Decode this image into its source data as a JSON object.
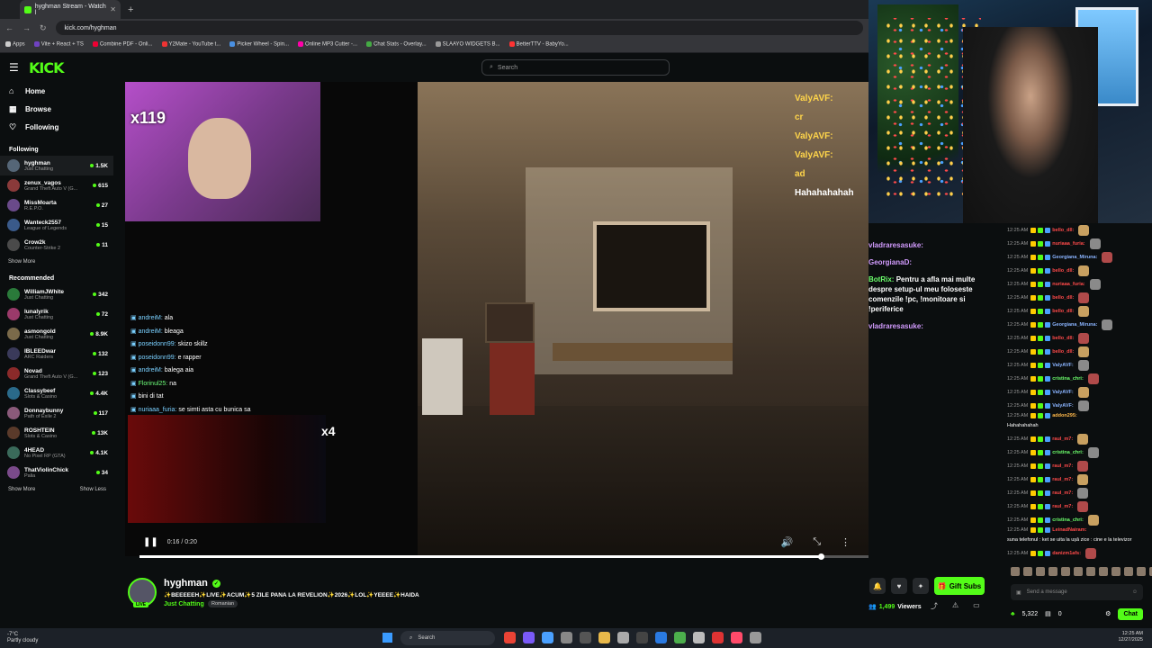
{
  "browser": {
    "tab_title": "hyghman Stream - Watch l",
    "url": "kick.com/hyghman",
    "bookmarks": [
      "Apps",
      "Vite + React + TS",
      "Combine PDF - Onli...",
      "Y2Mate - YouTube t...",
      "Picker Wheel - Spin...",
      "Online MP3 Cutter -...",
      "Chat Stats - Overlay...",
      "SLAAYO WIDGETS B...",
      "BetterTTV - BabyYo..."
    ]
  },
  "header": {
    "logo": "KICK",
    "search_placeholder": "Search"
  },
  "sidebar": {
    "nav": [
      {
        "label": "Home",
        "icon": "home-icon"
      },
      {
        "label": "Browse",
        "icon": "browse-icon"
      },
      {
        "label": "Following",
        "icon": "heart-icon"
      }
    ],
    "following_title": "Following",
    "following": [
      {
        "name": "hyghman",
        "category": "Just Chatting",
        "viewers": "1.5K",
        "color": "#556677"
      },
      {
        "name": "zenux_vagos",
        "category": "Grand Theft Auto V (G...",
        "viewers": "615",
        "color": "#8a3a3a"
      },
      {
        "name": "MissMoarta",
        "category": "R.E.P.O.",
        "viewers": "27",
        "color": "#6a4a8a"
      },
      {
        "name": "Wanteck2557",
        "category": "League of Legends",
        "viewers": "15",
        "color": "#3a5a8a"
      },
      {
        "name": "Crow2k",
        "category": "Counter-Strike 2",
        "viewers": "11",
        "color": "#4a4a4a"
      }
    ],
    "show_more": "Show More",
    "recommended_title": "Recommended",
    "recommended": [
      {
        "name": "WilliamJWhite",
        "category": "Just Chatting",
        "viewers": "342",
        "color": "#2a7a3a"
      },
      {
        "name": "lunalyrik",
        "category": "Just Chatting",
        "viewers": "72",
        "color": "#9a3a6a"
      },
      {
        "name": "asmongold",
        "category": "Just Chatting",
        "viewers": "8.9K",
        "color": "#7a6a4a"
      },
      {
        "name": "IBLEEDwar",
        "category": "ARC Raiders",
        "viewers": "132",
        "color": "#3a3a5a"
      },
      {
        "name": "Novad",
        "category": "Grand Theft Auto V (G...",
        "viewers": "123",
        "color": "#8a2a2a"
      },
      {
        "name": "Classybeef",
        "category": "Slots & Casino",
        "viewers": "4.4K",
        "color": "#2a6a8a"
      },
      {
        "name": "Donnaybunny",
        "category": "Path of Exile 2",
        "viewers": "117",
        "color": "#8a5a7a"
      },
      {
        "name": "ROSHTEIN",
        "category": "Slots & Casino",
        "viewers": "13K",
        "color": "#5a3a2a"
      },
      {
        "name": "4HEAD",
        "category": "No Pixel RP (GTA)",
        "viewers": "4.1K",
        "color": "#3a6a5a"
      },
      {
        "name": "ThatViolinChick",
        "category": "Palia",
        "viewers": "34",
        "color": "#7a4a8a"
      }
    ],
    "show_less": "Show Less"
  },
  "video": {
    "top_cam_badge": "x119",
    "bottom_cam_badge": "x4",
    "overlay_chat": [
      {
        "user": "andreiM:",
        "msg": "ala",
        "cls": "u1"
      },
      {
        "user": "andreiM:",
        "msg": "bleaga",
        "cls": "u1"
      },
      {
        "user": "poseidonn99:",
        "msg": "skizo skillz",
        "cls": "u1"
      },
      {
        "user": "poseidonn99:",
        "msg": "e rapper",
        "cls": "u1"
      },
      {
        "user": "andreiM:",
        "msg": "balega aia",
        "cls": "u1"
      },
      {
        "user": "Florinul25:",
        "msg": "na",
        "cls": "u3"
      },
      {
        "user": "",
        "msg": "bini di tat",
        "cls": "u2"
      },
      {
        "user": "nuriaaa_furia:",
        "msg": "se simti asta cu bunica sa",
        "cls": "u1"
      }
    ],
    "right_chat": [
      "ValyAVF:",
      "cr",
      "ValyAVF:",
      "ValyAVF:",
      "ad",
      "Hahahahahah"
    ],
    "time": "0:16 / 0:20",
    "progress": 0.935
  },
  "float_chat": [
    {
      "user": "vladraresasuke:",
      "msg": "",
      "cls": "uv"
    },
    {
      "user": "GeorgianaD:",
      "msg": "",
      "cls": "uv"
    },
    {
      "user": "BotRix:",
      "msg": "Pentru a afla mai multe despre setup-ul meu foloseste comenzile !pc, !monitoare si !periferice",
      "cls": "ug"
    },
    {
      "user": "vladraresasuke:",
      "msg": "",
      "cls": "uv"
    }
  ],
  "streamer": {
    "name": "hyghman",
    "live": "LIVE",
    "title": "✨BEEEEEH✨LIVE✨ACUM✨5 ZILE PANA LA REVELION✨2026✨LOL✨YEEEE✨HAIDA",
    "category": "Just Chatting",
    "language": "Romanian",
    "viewers": "1,499",
    "viewers_label": "Viewers",
    "gift_label": "Gift Subs"
  },
  "chat": {
    "messages": [
      {
        "time": "12:25 AM",
        "user": "bello_dll:",
        "ucolor": "#ff4a4a",
        "msg": ""
      },
      {
        "time": "12:25 AM",
        "user": "nuriaaa_furia:",
        "ucolor": "#ff4a4a",
        "msg": ""
      },
      {
        "time": "12:25 AM",
        "user": "Georgiana_Miruna:",
        "ucolor": "#8ab4ff",
        "msg": ""
      },
      {
        "time": "12:25 AM",
        "user": "bello_dll:",
        "ucolor": "#ff4a4a",
        "msg": ""
      },
      {
        "time": "12:25 AM",
        "user": "nuriaaa_furia:",
        "ucolor": "#ff4a4a",
        "msg": ""
      },
      {
        "time": "12:25 AM",
        "user": "bello_dll:",
        "ucolor": "#ff4a4a",
        "msg": ""
      },
      {
        "time": "12:25 AM",
        "user": "bello_dll:",
        "ucolor": "#ff4a4a",
        "msg": ""
      },
      {
        "time": "12:25 AM",
        "user": "Georgiana_Miruna:",
        "ucolor": "#8ab4ff",
        "msg": ""
      },
      {
        "time": "12:25 AM",
        "user": "bello_dll:",
        "ucolor": "#ff4a4a",
        "msg": ""
      },
      {
        "time": "12:25 AM",
        "user": "bello_dll:",
        "ucolor": "#ff4a4a",
        "msg": ""
      },
      {
        "time": "12:25 AM",
        "user": "ValyAVF:",
        "ucolor": "#8ab4ff",
        "msg": ""
      },
      {
        "time": "12:25 AM",
        "user": "cristina_chri:",
        "ucolor": "#6cff6c",
        "msg": ""
      },
      {
        "time": "12:25 AM",
        "user": "ValyAVF:",
        "ucolor": "#8ab4ff",
        "msg": ""
      },
      {
        "time": "12:25 AM",
        "user": "ValyAVF:",
        "ucolor": "#8ab4ff",
        "msg": ""
      },
      {
        "time": "12:25 AM",
        "user": "addon295:",
        "ucolor": "#ffb84a",
        "msg": "Hahahahahah",
        "tall": true
      },
      {
        "time": "12:25 AM",
        "user": "raul_m7:",
        "ucolor": "#ff4a4a",
        "msg": ""
      },
      {
        "time": "12:25 AM",
        "user": "cristina_chri:",
        "ucolor": "#6cff6c",
        "msg": ""
      },
      {
        "time": "12:25 AM",
        "user": "raul_m7:",
        "ucolor": "#ff4a4a",
        "msg": ""
      },
      {
        "time": "12:25 AM",
        "user": "raul_m7:",
        "ucolor": "#ff4a4a",
        "msg": ""
      },
      {
        "time": "12:25 AM",
        "user": "raul_m7:",
        "ucolor": "#ff4a4a",
        "msg": ""
      },
      {
        "time": "12:25 AM",
        "user": "raul_m7:",
        "ucolor": "#ff4a4a",
        "msg": ""
      },
      {
        "time": "12:25 AM",
        "user": "cristina_chri:",
        "ucolor": "#6cff6c",
        "msg": ""
      },
      {
        "time": "12:25 AM",
        "user": "LeinadNairam:",
        "ucolor": "#ff4a4a",
        "msg": "suna telefonul : ket se uita la ușă zice : cine e la televizor",
        "tall": true
      },
      {
        "time": "12:25 AM",
        "user": "danizm1afs:",
        "ucolor": "#ff4a4a",
        "msg": ""
      }
    ],
    "input_placeholder": "Send a message",
    "points": "5,322",
    "zero": "0",
    "chat_button": "Chat"
  },
  "taskbar": {
    "weather_temp": "-7°C",
    "weather_desc": "Partly cloudy",
    "search": "Search",
    "time": "12:25 AM",
    "date": "12/27/2025"
  }
}
